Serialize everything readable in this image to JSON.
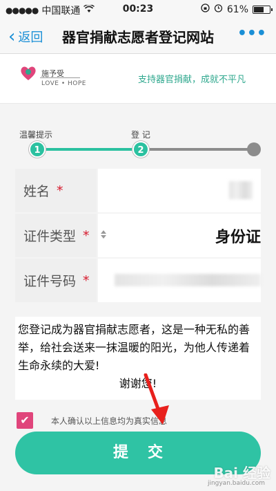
{
  "status_bar": {
    "carrier": "中国联通",
    "time": "00:23",
    "battery": "61%"
  },
  "nav": {
    "back_label": "返回",
    "title": "器官捐献志愿者登记网站",
    "more_label": "•••"
  },
  "banner": {
    "brand_cn": "施予受",
    "brand_en": "LOVE • HOPE",
    "slogan": "支持器官捐献，成就不平凡",
    "accent_color": "#2fa88e"
  },
  "steps": [
    {
      "label": "温馨提示",
      "number": "1",
      "state": "done"
    },
    {
      "label": "登 记",
      "number": "2",
      "state": "current"
    },
    {
      "label": "",
      "number": "",
      "state": "pending"
    }
  ],
  "form": {
    "fields": [
      {
        "label": "姓名",
        "required_mark": "*",
        "value": ""
      },
      {
        "label": "证件类型",
        "required_mark": "*",
        "value": "身份证"
      },
      {
        "label": "证件号码",
        "required_mark": "*",
        "value": ""
      }
    ]
  },
  "message": {
    "body": "您登记成为器官捐献志愿者，这是一种无私的善举，给社会送来一抹温暖的阳光，为他人传递着生命永续的大爱!",
    "thanks": "谢谢您!"
  },
  "confirm": {
    "checked": true,
    "text": "本人确认以上信息均为真实信息"
  },
  "submit": {
    "label": "提交",
    "color": "#2fc3a4"
  },
  "watermark": {
    "main": "Bai 经验",
    "sub": "jingyan.baidu.com"
  }
}
